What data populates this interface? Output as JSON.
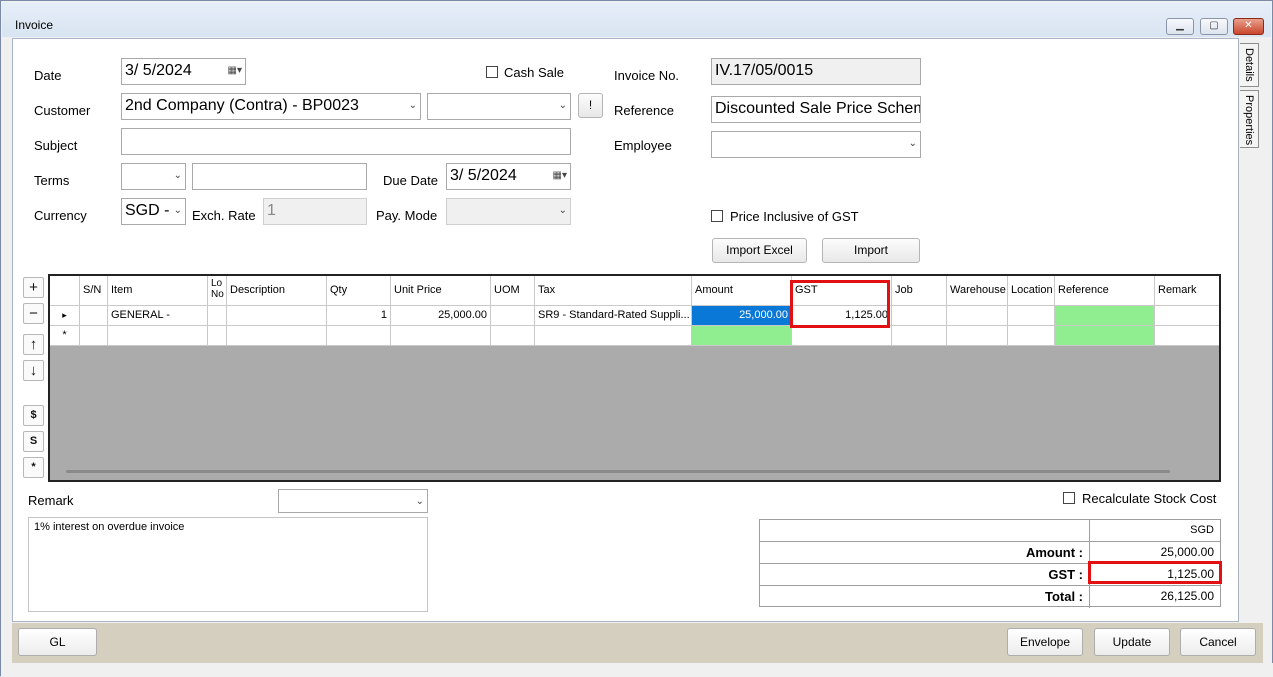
{
  "window": {
    "title": "Invoice",
    "min_icon": "minimize-icon",
    "max_icon": "maximize-icon",
    "close_icon": "close-icon"
  },
  "side_tabs": [
    "Details",
    "Properties"
  ],
  "form": {
    "date_label": "Date",
    "date_value": "3/  5/2024",
    "cash_sale_label": "Cash Sale",
    "invoice_no_label": "Invoice No.",
    "invoice_no_value": "IV.17/05/0015",
    "customer_label": "Customer",
    "customer_value": "2nd Company (Contra) - BP0023",
    "customer_extra_value": "",
    "bang_button": "!",
    "reference_label": "Reference",
    "reference_value": "Discounted Sale Price Scheme",
    "subject_label": "Subject",
    "subject_value": "",
    "employee_label": "Employee",
    "employee_value": "",
    "terms_label": "Terms",
    "terms_value": "",
    "terms_text": "",
    "due_date_label": "Due Date",
    "due_date_value": "3/  5/2024",
    "currency_label": "Currency",
    "currency_value": "SGD -",
    "exch_rate_label": "Exch. Rate",
    "exch_rate_value": "1",
    "pay_mode_label": "Pay. Mode",
    "pay_mode_value": "",
    "price_inclusive_label": "Price Inclusive of GST",
    "import_excel_button": "Import Excel",
    "import_button": "Import"
  },
  "side_buttons": [
    "+",
    "−",
    "↑",
    "↓",
    "$",
    "S",
    "*"
  ],
  "grid": {
    "columns": [
      "S/N",
      "Item",
      "Lo\nNo",
      "Description",
      "Qty",
      "Unit Price",
      "UOM",
      "Tax",
      "Amount",
      "GST",
      "Job",
      "Warehouse",
      "Location",
      "Reference",
      "Remark"
    ],
    "rows": [
      {
        "marker": "▸",
        "sn": "",
        "item": "GENERAL -",
        "lot": "",
        "description": "",
        "qty": "1",
        "unit_price": "25,000.00",
        "uom": "",
        "tax": "SR9 - Standard-Rated Suppli...",
        "amount": "25,000.00",
        "gst": "1,125.00",
        "job": "",
        "warehouse": "",
        "location": "",
        "reference": "",
        "remark": ""
      },
      {
        "marker": "*",
        "sn": "",
        "item": "",
        "lot": "",
        "description": "",
        "qty": "",
        "unit_price": "",
        "uom": "",
        "tax": "",
        "amount": "",
        "gst": "",
        "job": "",
        "warehouse": "",
        "location": "",
        "reference": "",
        "remark": ""
      }
    ]
  },
  "remark": {
    "label": "Remark",
    "dropdown_value": "",
    "text": "1% interest on overdue invoice",
    "recalc_label": "Recalculate Stock Cost"
  },
  "totals": {
    "currency": "SGD",
    "amount_label": "Amount :",
    "amount_value": "25,000.00",
    "gst_label": "GST :",
    "gst_value": "1,125.00",
    "total_label": "Total :",
    "total_value": "26,125.00"
  },
  "footer": {
    "gl_button": "GL",
    "envelope_button": "Envelope",
    "update_button": "Update",
    "cancel_button": "Cancel"
  },
  "colors": {
    "selection": "#0a78d7",
    "highlight_green": "#90ee90",
    "annotation_red": "#e21010"
  }
}
